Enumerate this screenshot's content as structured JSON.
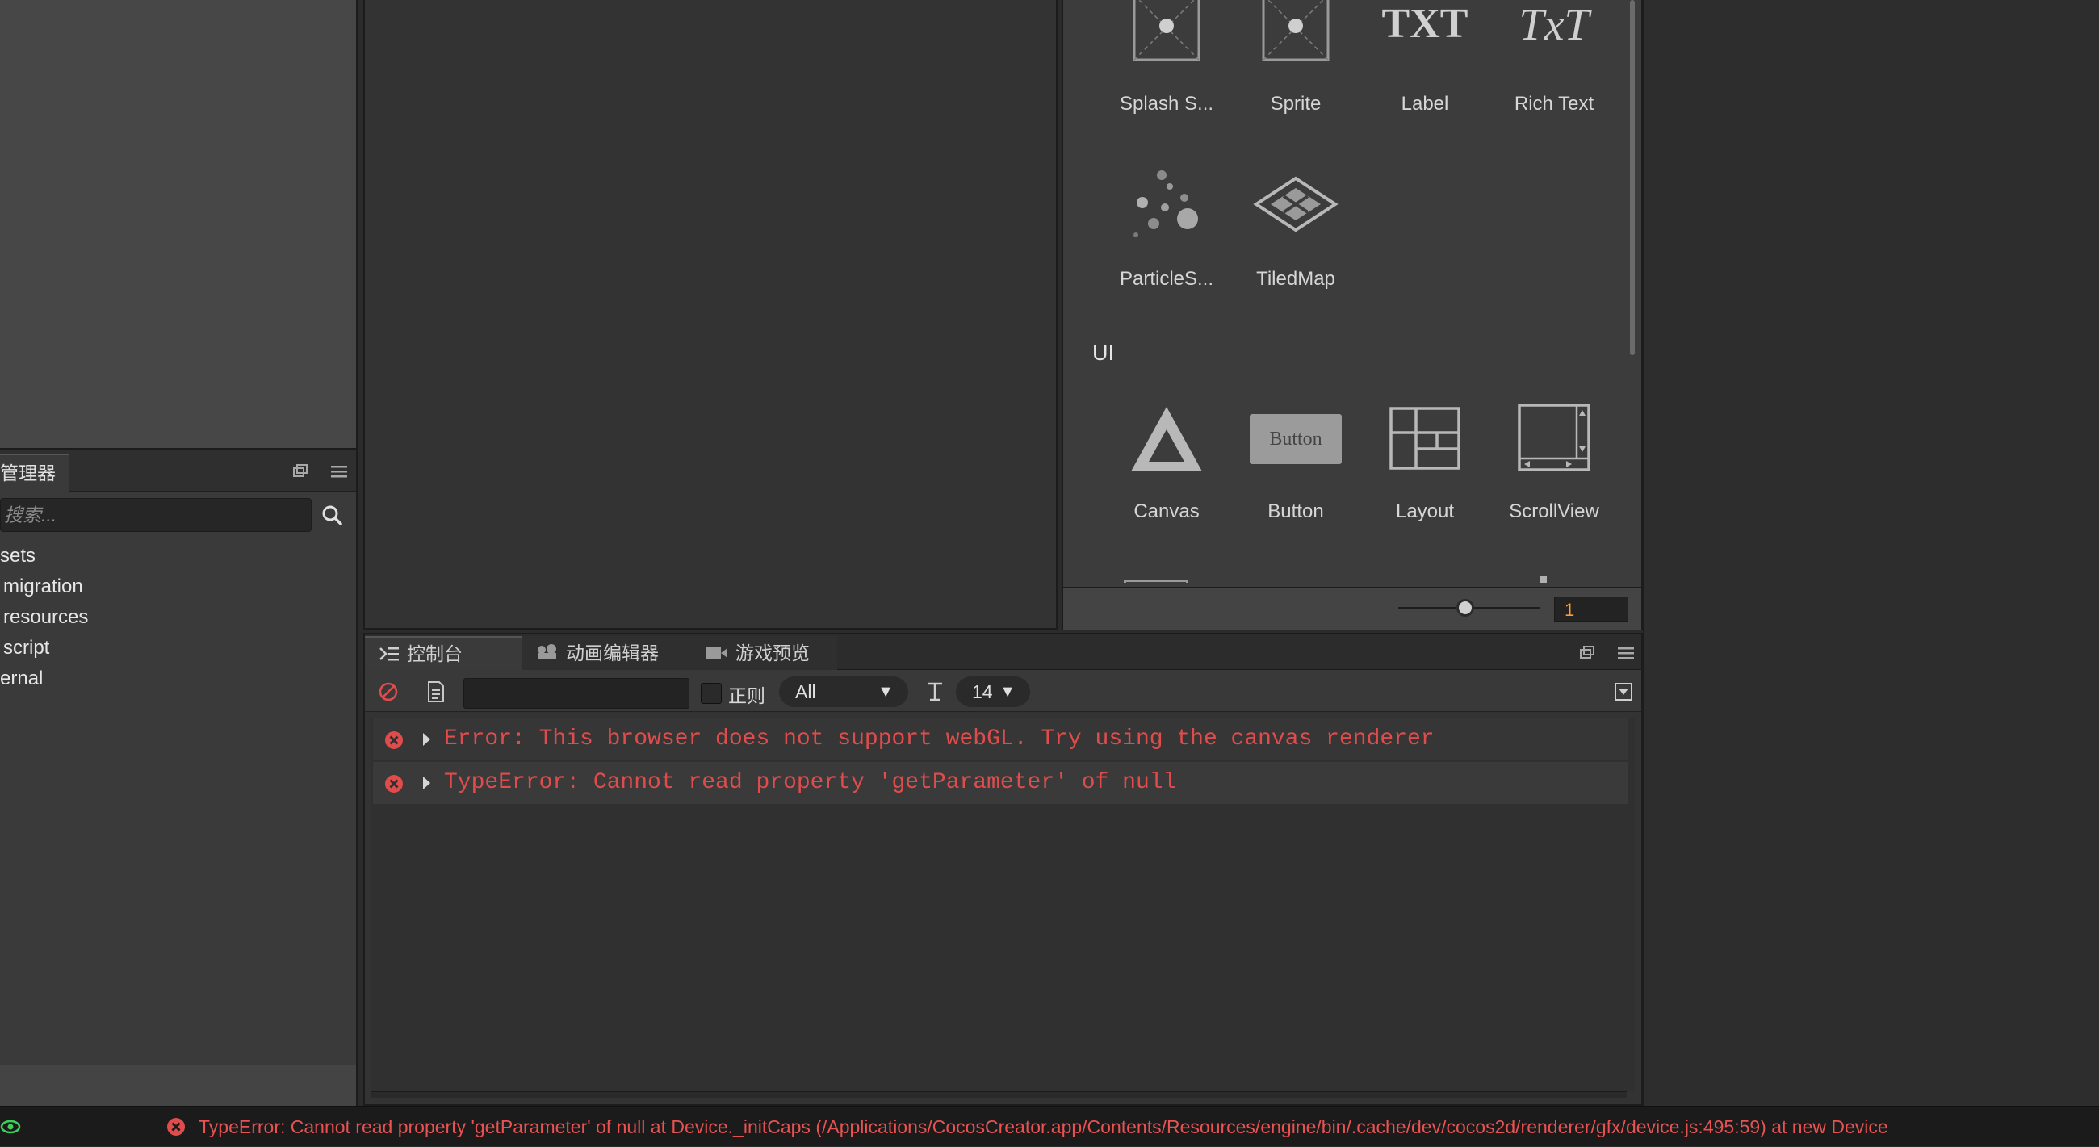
{
  "assets_panel": {
    "tab_label": "管理器",
    "search_placeholder": "搜索...",
    "tree": [
      "sets",
      "migration",
      "resources",
      "script",
      "ernal"
    ]
  },
  "node_library": {
    "items_row1": [
      "Splash S...",
      "Sprite",
      "Label",
      "Rich Text"
    ],
    "items_row2": [
      "ParticleS...",
      "TiledMap"
    ],
    "section_ui": "UI",
    "items_ui": [
      "Canvas",
      "Button",
      "Layout",
      "ScrollView"
    ],
    "button_icon_text": "Button",
    "txt_icon_text": "TXT",
    "richtext_icon_text": "TxT",
    "zoom_value": "1"
  },
  "console": {
    "tabs": {
      "console": "控制台",
      "animation": "动画编辑器",
      "preview": "游戏预览"
    },
    "regex_label": "正则",
    "level": "All",
    "font_size": "14",
    "logs": [
      "Error: This browser does not support webGL. Try using the canvas renderer",
      "TypeError: Cannot read property 'getParameter' of null"
    ]
  },
  "status_bar": {
    "message": "TypeError: Cannot read property 'getParameter' of null at Device._initCaps (/Applications/CocosCreator.app/Contents/Resources/engine/bin/.cache/dev/cocos2d/renderer/gfx/device.js:495:59) at new Device"
  },
  "colors": {
    "error": "#e04c4c",
    "accent_zoom": "#ff9e2c",
    "status_ok": "#3fcf5b"
  }
}
